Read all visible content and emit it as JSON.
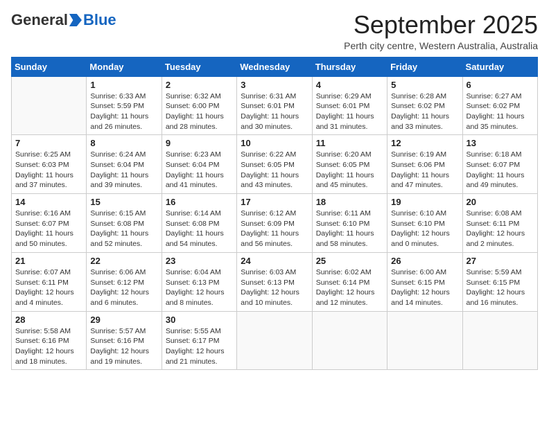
{
  "logo": {
    "general": "General",
    "blue": "Blue"
  },
  "title": "September 2025",
  "location": "Perth city centre, Western Australia, Australia",
  "days_header": [
    "Sunday",
    "Monday",
    "Tuesday",
    "Wednesday",
    "Thursday",
    "Friday",
    "Saturday"
  ],
  "weeks": [
    [
      {
        "num": "",
        "info": ""
      },
      {
        "num": "1",
        "info": "Sunrise: 6:33 AM\nSunset: 5:59 PM\nDaylight: 11 hours\nand 26 minutes."
      },
      {
        "num": "2",
        "info": "Sunrise: 6:32 AM\nSunset: 6:00 PM\nDaylight: 11 hours\nand 28 minutes."
      },
      {
        "num": "3",
        "info": "Sunrise: 6:31 AM\nSunset: 6:01 PM\nDaylight: 11 hours\nand 30 minutes."
      },
      {
        "num": "4",
        "info": "Sunrise: 6:29 AM\nSunset: 6:01 PM\nDaylight: 11 hours\nand 31 minutes."
      },
      {
        "num": "5",
        "info": "Sunrise: 6:28 AM\nSunset: 6:02 PM\nDaylight: 11 hours\nand 33 minutes."
      },
      {
        "num": "6",
        "info": "Sunrise: 6:27 AM\nSunset: 6:02 PM\nDaylight: 11 hours\nand 35 minutes."
      }
    ],
    [
      {
        "num": "7",
        "info": "Sunrise: 6:25 AM\nSunset: 6:03 PM\nDaylight: 11 hours\nand 37 minutes."
      },
      {
        "num": "8",
        "info": "Sunrise: 6:24 AM\nSunset: 6:04 PM\nDaylight: 11 hours\nand 39 minutes."
      },
      {
        "num": "9",
        "info": "Sunrise: 6:23 AM\nSunset: 6:04 PM\nDaylight: 11 hours\nand 41 minutes."
      },
      {
        "num": "10",
        "info": "Sunrise: 6:22 AM\nSunset: 6:05 PM\nDaylight: 11 hours\nand 43 minutes."
      },
      {
        "num": "11",
        "info": "Sunrise: 6:20 AM\nSunset: 6:05 PM\nDaylight: 11 hours\nand 45 minutes."
      },
      {
        "num": "12",
        "info": "Sunrise: 6:19 AM\nSunset: 6:06 PM\nDaylight: 11 hours\nand 47 minutes."
      },
      {
        "num": "13",
        "info": "Sunrise: 6:18 AM\nSunset: 6:07 PM\nDaylight: 11 hours\nand 49 minutes."
      }
    ],
    [
      {
        "num": "14",
        "info": "Sunrise: 6:16 AM\nSunset: 6:07 PM\nDaylight: 11 hours\nand 50 minutes."
      },
      {
        "num": "15",
        "info": "Sunrise: 6:15 AM\nSunset: 6:08 PM\nDaylight: 11 hours\nand 52 minutes."
      },
      {
        "num": "16",
        "info": "Sunrise: 6:14 AM\nSunset: 6:08 PM\nDaylight: 11 hours\nand 54 minutes."
      },
      {
        "num": "17",
        "info": "Sunrise: 6:12 AM\nSunset: 6:09 PM\nDaylight: 11 hours\nand 56 minutes."
      },
      {
        "num": "18",
        "info": "Sunrise: 6:11 AM\nSunset: 6:10 PM\nDaylight: 11 hours\nand 58 minutes."
      },
      {
        "num": "19",
        "info": "Sunrise: 6:10 AM\nSunset: 6:10 PM\nDaylight: 12 hours\nand 0 minutes."
      },
      {
        "num": "20",
        "info": "Sunrise: 6:08 AM\nSunset: 6:11 PM\nDaylight: 12 hours\nand 2 minutes."
      }
    ],
    [
      {
        "num": "21",
        "info": "Sunrise: 6:07 AM\nSunset: 6:11 PM\nDaylight: 12 hours\nand 4 minutes."
      },
      {
        "num": "22",
        "info": "Sunrise: 6:06 AM\nSunset: 6:12 PM\nDaylight: 12 hours\nand 6 minutes."
      },
      {
        "num": "23",
        "info": "Sunrise: 6:04 AM\nSunset: 6:13 PM\nDaylight: 12 hours\nand 8 minutes."
      },
      {
        "num": "24",
        "info": "Sunrise: 6:03 AM\nSunset: 6:13 PM\nDaylight: 12 hours\nand 10 minutes."
      },
      {
        "num": "25",
        "info": "Sunrise: 6:02 AM\nSunset: 6:14 PM\nDaylight: 12 hours\nand 12 minutes."
      },
      {
        "num": "26",
        "info": "Sunrise: 6:00 AM\nSunset: 6:15 PM\nDaylight: 12 hours\nand 14 minutes."
      },
      {
        "num": "27",
        "info": "Sunrise: 5:59 AM\nSunset: 6:15 PM\nDaylight: 12 hours\nand 16 minutes."
      }
    ],
    [
      {
        "num": "28",
        "info": "Sunrise: 5:58 AM\nSunset: 6:16 PM\nDaylight: 12 hours\nand 18 minutes."
      },
      {
        "num": "29",
        "info": "Sunrise: 5:57 AM\nSunset: 6:16 PM\nDaylight: 12 hours\nand 19 minutes."
      },
      {
        "num": "30",
        "info": "Sunrise: 5:55 AM\nSunset: 6:17 PM\nDaylight: 12 hours\nand 21 minutes."
      },
      {
        "num": "",
        "info": ""
      },
      {
        "num": "",
        "info": ""
      },
      {
        "num": "",
        "info": ""
      },
      {
        "num": "",
        "info": ""
      }
    ]
  ]
}
